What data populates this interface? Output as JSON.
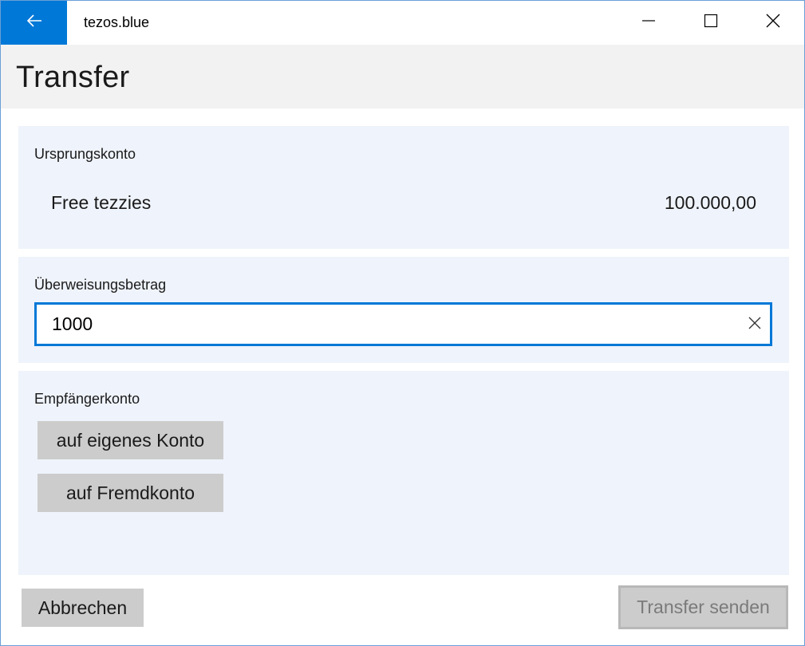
{
  "window": {
    "app_title": "tezos.blue",
    "back_icon": "arrow-left-icon",
    "controls": {
      "minimize_icon": "minimize-icon",
      "maximize_icon": "maximize-icon",
      "close_icon": "close-icon"
    },
    "accent_color": "#0078d7"
  },
  "page": {
    "title": "Transfer"
  },
  "origin": {
    "label": "Ursprungskonto",
    "account_name": "Free tezzies",
    "balance": "100.000,00"
  },
  "amount": {
    "label": "Überweisungsbetrag",
    "value": "1000",
    "clear_icon": "clear-x-icon"
  },
  "recipient": {
    "label": "Empfängerkonto",
    "own_account_button": "auf eigenes Konto",
    "foreign_account_button": "auf Fremdkonto"
  },
  "footer": {
    "cancel_button": "Abbrechen",
    "send_button": "Transfer senden",
    "send_disabled": true
  }
}
